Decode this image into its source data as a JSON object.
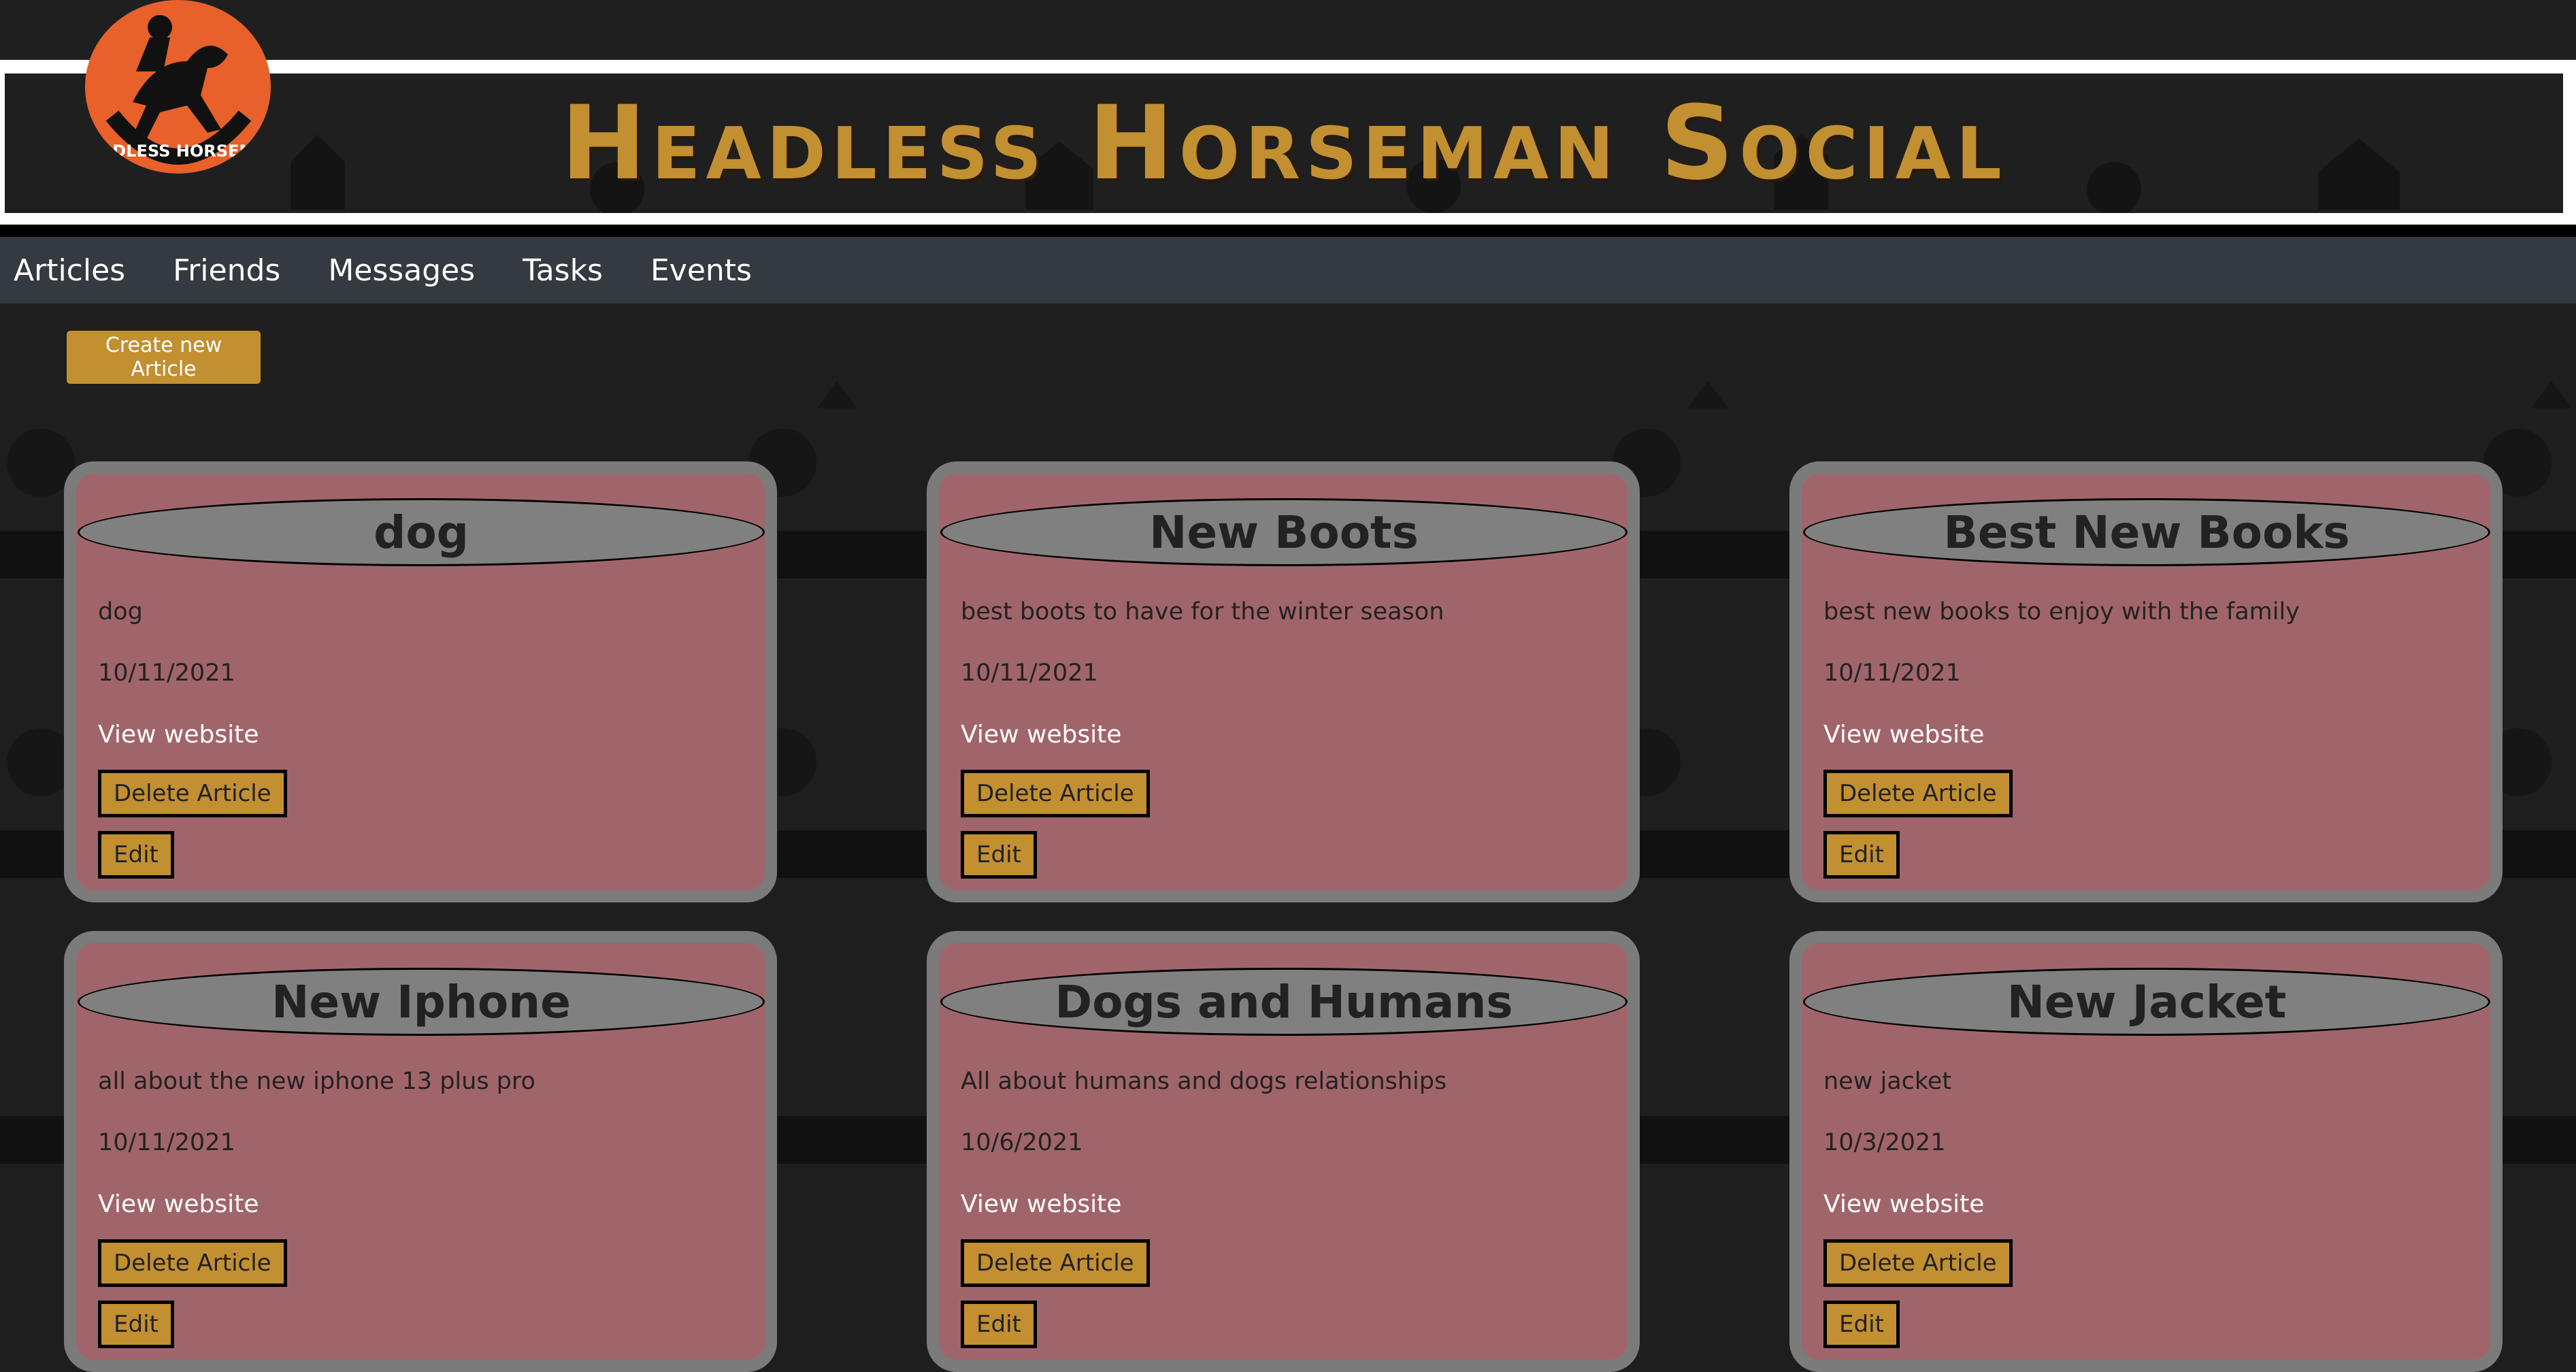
{
  "header": {
    "site_title": "Headless Horseman Social",
    "logo_text": "HEADLESS HORSEMEN"
  },
  "nav": {
    "items": [
      "Articles",
      "Friends",
      "Messages",
      "Tasks",
      "Events"
    ]
  },
  "actions": {
    "create_label": "Create new Article"
  },
  "articles": [
    {
      "title": "dog",
      "description": "dog",
      "date": "10/11/2021",
      "link": "View website",
      "delete": "Delete Article",
      "edit": "Edit"
    },
    {
      "title": "New Boots",
      "description": "best boots to have for the winter season",
      "date": "10/11/2021",
      "link": "View website",
      "delete": "Delete Article",
      "edit": "Edit"
    },
    {
      "title": "Best New Books",
      "description": "best new books to enjoy with the family",
      "date": "10/11/2021",
      "link": "View website",
      "delete": "Delete Article",
      "edit": "Edit"
    },
    {
      "title": "New Iphone",
      "description": "all about the new iphone 13 plus pro",
      "date": "10/11/2021",
      "link": "View website",
      "delete": "Delete Article",
      "edit": "Edit"
    },
    {
      "title": "Dogs and Humans",
      "description": "All about humans and dogs relationships",
      "date": "10/6/2021",
      "link": "View website",
      "delete": "Delete Article",
      "edit": "Edit"
    },
    {
      "title": "New Jacket",
      "description": "new jacket",
      "date": "10/3/2021",
      "link": "View website",
      "delete": "Delete Article",
      "edit": "Edit"
    }
  ],
  "colors": {
    "accent": "#c28f31",
    "card_bg": "#a0656a",
    "card_border": "#7b7b7b",
    "nav_bg": "#343a40",
    "page_bg": "#1e1e1e",
    "logo_bg": "#e8602a"
  }
}
